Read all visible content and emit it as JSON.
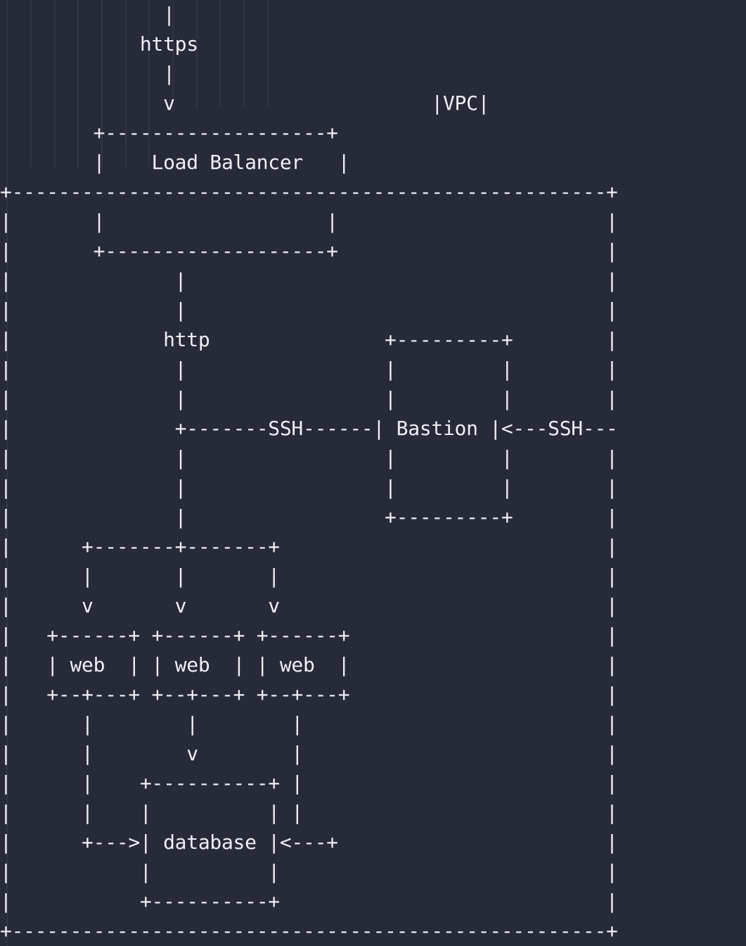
{
  "diagram": {
    "lines": [
      "              |",
      "            https",
      "              |",
      "              v                      |VPC|",
      "        +-------------------+",
      "        |    Load Balancer   |",
      "+---------------------------------------------------+",
      "|       |                   |                       |",
      "|       +-------------------+                       |",
      "|              |                                    |",
      "|              |                                    |",
      "|             http               +---------+        |",
      "|              |                 |         |        |",
      "|              |                 |         |        |",
      "|              +-------SSH------| Bastion |<---SSH---",
      "|              |                 |         |        |",
      "|              |                 |         |        |",
      "|              |                 +---------+        |",
      "|      +-------+-------+                            |",
      "|      |       |       |                            |",
      "|      v       v       v                            |",
      "|   +------+ +------+ +------+                      |",
      "|   | web  | | web  | | web  |                      |",
      "|   +--+---+ +--+---+ +--+---+                      |",
      "|      |        |        |                          |",
      "|      |        v        |                          |",
      "|      |    +----------+ |                          |",
      "|      |    |          | |                          |",
      "|      +--->| database |<---+                       |",
      "|           |          |                            |",
      "|           +----------+                            |",
      "+---------------------------------------------------+"
    ]
  }
}
